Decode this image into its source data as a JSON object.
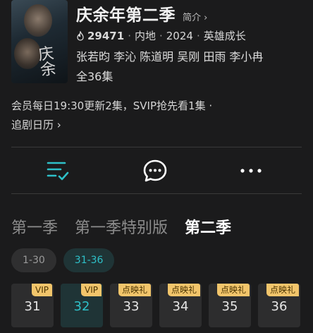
{
  "show": {
    "title": "庆余年第二季",
    "intro_label": "简介",
    "heat": "29471",
    "region": "内地",
    "year": "2024",
    "genre": "英雄成长",
    "cast": "张若昀 李沁 陈道明 吴刚 田雨 李小冉",
    "episode_count": "全36集",
    "poster_text": "庆余"
  },
  "notice": {
    "text": "会员每日19:30更新2集，SVIP抢先看1集 ·",
    "calendar_label": "追剧日历"
  },
  "actions": [
    {
      "icon": "episode-list-icon"
    },
    {
      "icon": "comment-icon"
    },
    {
      "icon": "more-icon"
    }
  ],
  "seasons": [
    "第一季",
    "第一季特别版",
    "第二季"
  ],
  "ranges": [
    "1-30",
    "31-36"
  ],
  "episodes": [
    {
      "num": "31",
      "badge": "VIP"
    },
    {
      "num": "32",
      "badge": "VIP"
    },
    {
      "num": "33",
      "badge": "点映礼"
    },
    {
      "num": "34",
      "badge": "点映礼"
    },
    {
      "num": "35",
      "badge": "点映礼"
    },
    {
      "num": "36",
      "badge": "点映礼"
    }
  ],
  "colors": {
    "accent": "#2ec0c8",
    "badge": "#f2c56b",
    "background": "#1b1b1c"
  }
}
